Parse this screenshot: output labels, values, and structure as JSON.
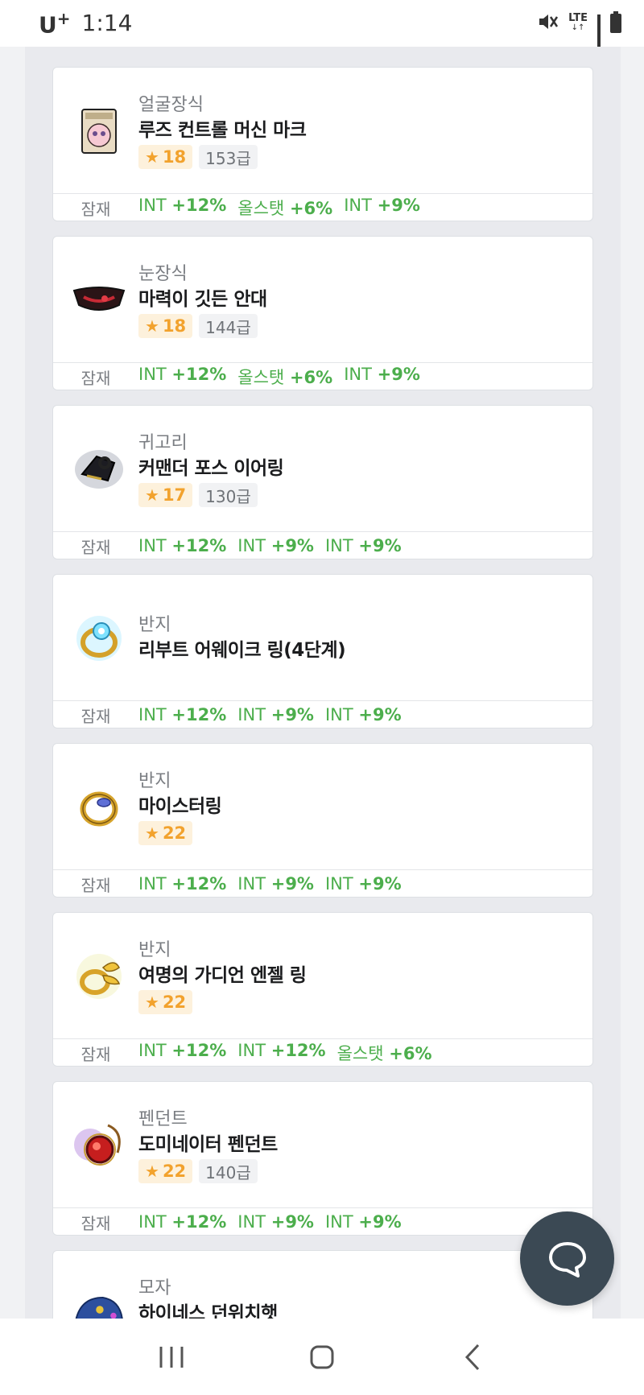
{
  "status_bar": {
    "carrier": "U",
    "carrier_sup": "+",
    "time": "1:14",
    "network": "LTE",
    "icons": [
      "mute-icon",
      "lte-icon",
      "signal-icon",
      "battery-icon"
    ]
  },
  "potential_label": "잠재",
  "items": [
    {
      "category": "얼굴장식",
      "name": "루즈 컨트롤 머신 마크",
      "star": "18",
      "level": "153급",
      "potentials": [
        {
          "stat": "INT",
          "value": "+12%"
        },
        {
          "stat": "올스탯",
          "value": "+6%"
        },
        {
          "stat": "INT",
          "value": "+9%"
        }
      ],
      "icon": "face-accessory-icon"
    },
    {
      "category": "눈장식",
      "name": "마력이 깃든 안대",
      "star": "18",
      "level": "144급",
      "potentials": [
        {
          "stat": "INT",
          "value": "+12%"
        },
        {
          "stat": "올스탯",
          "value": "+6%"
        },
        {
          "stat": "INT",
          "value": "+9%"
        }
      ],
      "icon": "eye-accessory-icon"
    },
    {
      "category": "귀고리",
      "name": "커맨더 포스 이어링",
      "star": "17",
      "level": "130급",
      "potentials": [
        {
          "stat": "INT",
          "value": "+12%"
        },
        {
          "stat": "INT",
          "value": "+9%"
        },
        {
          "stat": "INT",
          "value": "+9%"
        }
      ],
      "icon": "earring-icon"
    },
    {
      "category": "반지",
      "name": "리부트 어웨이크 링(4단계)",
      "star": "",
      "level": "",
      "potentials": [
        {
          "stat": "INT",
          "value": "+12%"
        },
        {
          "stat": "INT",
          "value": "+9%"
        },
        {
          "stat": "INT",
          "value": "+9%"
        }
      ],
      "icon": "ring-icon"
    },
    {
      "category": "반지",
      "name": "마이스터링",
      "star": "22",
      "level": "",
      "potentials": [
        {
          "stat": "INT",
          "value": "+12%"
        },
        {
          "stat": "INT",
          "value": "+9%"
        },
        {
          "stat": "INT",
          "value": "+9%"
        }
      ],
      "icon": "ring-icon"
    },
    {
      "category": "반지",
      "name": "여명의 가디언 엔젤 링",
      "star": "22",
      "level": "",
      "potentials": [
        {
          "stat": "INT",
          "value": "+12%"
        },
        {
          "stat": "INT",
          "value": "+12%"
        },
        {
          "stat": "올스탯",
          "value": "+6%"
        }
      ],
      "icon": "ring-icon"
    },
    {
      "category": "펜던트",
      "name": "도미네이터 펜던트",
      "star": "22",
      "level": "140급",
      "potentials": [
        {
          "stat": "INT",
          "value": "+12%"
        },
        {
          "stat": "INT",
          "value": "+9%"
        },
        {
          "stat": "INT",
          "value": "+9%"
        }
      ],
      "icon": "pendant-icon"
    },
    {
      "category": "모자",
      "name": "하이네스 던위치햇",
      "star": "",
      "level": "",
      "potentials": [],
      "icon": "hat-icon"
    }
  ],
  "colors": {
    "star_badge_bg": "#fdf1dc",
    "star_text": "#f2a22d",
    "potential_text": "#4cae4c",
    "fab_bg": "#3b4954"
  },
  "nav": [
    "recent-apps-button",
    "home-button",
    "back-button"
  ]
}
